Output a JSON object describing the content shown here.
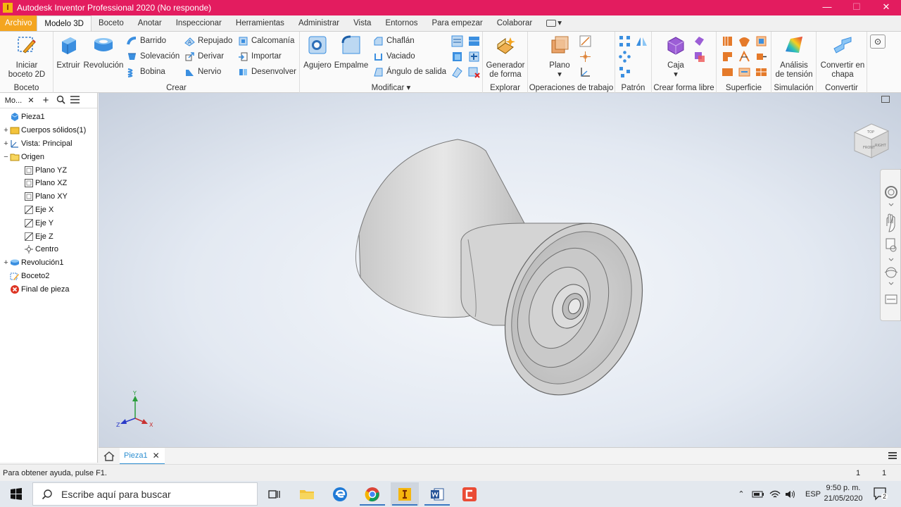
{
  "window": {
    "title": "Autodesk Inventor Professional 2020 (No responde)",
    "app_icon_letter": "I",
    "minimize": "—",
    "maximize": "☐",
    "close": "✕"
  },
  "ribbon_tabs": [
    "Archivo",
    "Modelo 3D",
    "Boceto",
    "Anotar",
    "Inspeccionar",
    "Herramientas",
    "Administrar",
    "Vista",
    "Entornos",
    "Para empezar",
    "Colaborar"
  ],
  "ribbon_tab_extra_arrow": "▾",
  "groups": {
    "boceto": {
      "label": "Boceto",
      "start_sketch_line1": "Iniciar",
      "start_sketch_line2": "boceto 2D"
    },
    "crear": {
      "label": "Crear",
      "extrude": "Extruir",
      "revolve": "Revolución",
      "sweep": "Barrido",
      "loft": "Solevación",
      "coil": "Bobina",
      "emboss": "Repujado",
      "derive": "Derivar",
      "rib": "Nervio",
      "decal": "Calcomanía",
      "import": "Importar",
      "unwrap": "Desenvolver"
    },
    "modificar": {
      "label": "Modificar",
      "hole": "Agujero",
      "fillet": "Empalme",
      "chamfer": "Chaflán",
      "shell": "Vaciado",
      "draft": "Ángulo de salida"
    },
    "explorar": {
      "label": "Explorar",
      "shape_gen_line1": "Generador",
      "shape_gen_line2": "de forma"
    },
    "operaciones": {
      "label": "Operaciones de trabajo",
      "plane": "Plano"
    },
    "patron": {
      "label": "Patrón"
    },
    "forma_libre": {
      "label": "Crear forma libre",
      "box": "Caja"
    },
    "superficie": {
      "label": "Superficie"
    },
    "simulacion": {
      "label": "Simulación",
      "stress_line1": "Análisis",
      "stress_line2": "de tensión"
    },
    "convertir": {
      "label": "Convertir",
      "sheet_line1": "Convertir en",
      "sheet_line2": "chapa"
    }
  },
  "browser": {
    "header_label": "Mo...",
    "close": "✕",
    "add": "+",
    "tree": [
      {
        "label": "Pieza1",
        "level": 0,
        "expander": "",
        "icon": "part-icon"
      },
      {
        "label": "Cuerpos sólidos(1)",
        "level": 0,
        "expander": "+",
        "icon": "folder-icon"
      },
      {
        "label": "Vista: Principal",
        "level": 0,
        "expander": "+",
        "icon": "view-icon"
      },
      {
        "label": "Origen",
        "level": 0,
        "expander": "−",
        "icon": "folder-open-icon"
      },
      {
        "label": "Plano YZ",
        "level": 1,
        "expander": "",
        "icon": "plane-icon"
      },
      {
        "label": "Plano XZ",
        "level": 1,
        "expander": "",
        "icon": "plane-icon"
      },
      {
        "label": "Plano XY",
        "level": 1,
        "expander": "",
        "icon": "plane-icon"
      },
      {
        "label": "Eje X",
        "level": 1,
        "expander": "",
        "icon": "axis-icon"
      },
      {
        "label": "Eje Y",
        "level": 1,
        "expander": "",
        "icon": "axis-icon"
      },
      {
        "label": "Eje Z",
        "level": 1,
        "expander": "",
        "icon": "axis-icon"
      },
      {
        "label": "Centro",
        "level": 1,
        "expander": "",
        "icon": "center-point-icon"
      },
      {
        "label": "Revolución1",
        "level": 0,
        "expander": "+",
        "icon": "revolve-feature-icon"
      },
      {
        "label": "Boceto2",
        "level": 0,
        "expander": "",
        "icon": "sketch-icon"
      },
      {
        "label": "Final de pieza",
        "level": 0,
        "expander": "",
        "icon": "end-of-part-icon"
      }
    ]
  },
  "viewcube": {
    "face_front": "FRONT",
    "face_right": "RIGHT",
    "face_top": "TOP"
  },
  "triad": {
    "x": "X",
    "y": "Y",
    "z": "Z"
  },
  "document_tabs": [
    {
      "label": "Pieza1",
      "close": "✕"
    }
  ],
  "status": {
    "help": "Para obtener ayuda, pulse F1.",
    "value1": "1",
    "value2": "1"
  },
  "taskbar": {
    "search_placeholder": "Escribe aquí para buscar",
    "language": "ESP",
    "time": "9:50 p. m.",
    "date": "21/05/2020",
    "notifications": "2"
  },
  "colors": {
    "title_bar": "#e31c5f",
    "file_tab": "#f4a51f",
    "accent": "#2e8fd1"
  }
}
